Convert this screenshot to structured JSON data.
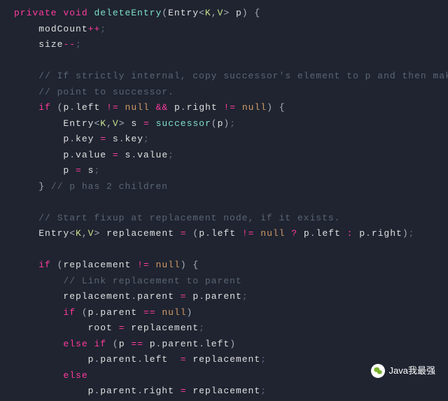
{
  "code": {
    "l1": {
      "priv": "private",
      "void": "void",
      "fn": "deleteEntry",
      "entry": "Entry",
      "K": "K",
      "V": "V",
      "p": "p"
    },
    "l2": {
      "id": "modCount",
      "op": "++"
    },
    "l3": {
      "id": "size",
      "op": "--"
    },
    "l4": "// If strictly internal, copy successor's element to p and then make",
    "l5": "// point to successor.",
    "l6": {
      "if": "if",
      "p": "p",
      "left": "left",
      "ne": "!=",
      "null": "null",
      "and": "&&",
      "right": "right"
    },
    "l7": {
      "entry": "Entry",
      "K": "K",
      "V": "V",
      "s": "s",
      "eq": "=",
      "fn": "successor",
      "p": "p"
    },
    "l8": {
      "p": "p",
      "key": "key",
      "eq": "=",
      "s": "s"
    },
    "l9": {
      "p": "p",
      "value": "value",
      "eq": "=",
      "s": "s"
    },
    "l10": {
      "p": "p",
      "eq": "=",
      "s": "s"
    },
    "l11": {
      "cm": "// p has 2 children"
    },
    "l12": "// Start fixup at replacement node, if it exists.",
    "l13": {
      "entry": "Entry",
      "K": "K",
      "V": "V",
      "rep": "replacement",
      "eq": "=",
      "p": "p",
      "left": "left",
      "ne": "!=",
      "null": "null",
      "q": "?",
      "c": ":",
      "right": "right"
    },
    "l14": {
      "if": "if",
      "rep": "replacement",
      "ne": "!=",
      "null": "null"
    },
    "l15": "// Link replacement to parent",
    "l16": {
      "rep": "replacement",
      "parent": "parent",
      "eq": "=",
      "p": "p"
    },
    "l17": {
      "if": "if",
      "p": "p",
      "parent": "parent",
      "eqeq": "==",
      "null": "null"
    },
    "l18": {
      "root": "root",
      "eq": "=",
      "rep": "replacement"
    },
    "l19": {
      "else": "else",
      "if": "if",
      "p": "p",
      "eqeq": "==",
      "parent": "parent",
      "left": "left"
    },
    "l20": {
      "p": "p",
      "parent": "parent",
      "left": "left",
      "eq": "=",
      "rep": "replacement"
    },
    "l21": {
      "else": "else"
    },
    "l22": {
      "p": "p",
      "parent": "parent",
      "right": "right",
      "eq": "=",
      "rep": "replacement"
    }
  },
  "badge": {
    "label": "Java我最强"
  }
}
